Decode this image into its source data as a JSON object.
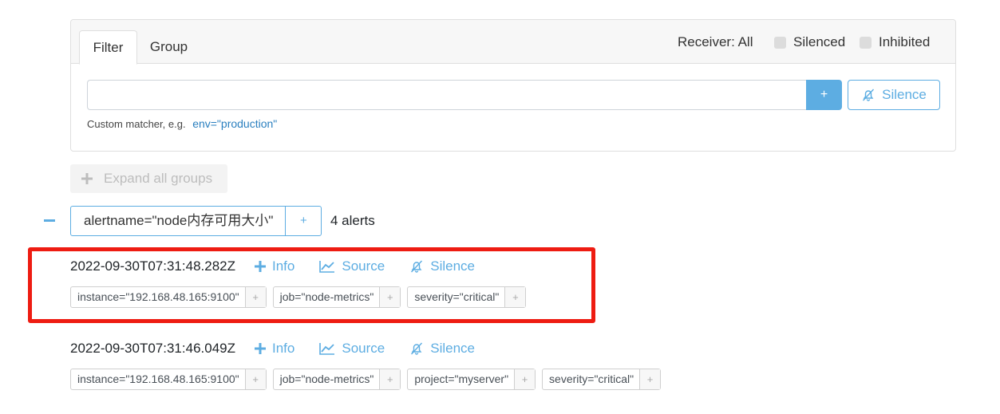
{
  "filter_card": {
    "tabs": [
      {
        "label": "Filter"
      },
      {
        "label": "Group"
      }
    ],
    "receiver": "Receiver: All",
    "silenced_label": "Silenced",
    "inhibited_label": "Inhibited",
    "input_value": "",
    "add_label": "+",
    "silence_label": "Silence",
    "hint_text": "Custom matcher, e.g.",
    "hint_example": "env=\"production\""
  },
  "expand_label": "Expand all groups",
  "group": {
    "label": "alertname=\"node内存可用大小\"",
    "plus": "+",
    "count": "4 alerts"
  },
  "alerts": [
    {
      "timestamp": "2022-09-30T07:31:48.282Z",
      "info": "Info",
      "source": "Source",
      "silence": "Silence",
      "labels": [
        "instance=\"192.168.48.165:9100\"",
        "job=\"node-metrics\"",
        "severity=\"critical\""
      ]
    },
    {
      "timestamp": "2022-09-30T07:31:46.049Z",
      "info": "Info",
      "source": "Source",
      "silence": "Silence",
      "labels": [
        "instance=\"192.168.48.165:9100\"",
        "job=\"node-metrics\"",
        "project=\"myserver\"",
        "severity=\"critical\""
      ]
    }
  ],
  "label_plus": "+",
  "colors": {
    "accent": "#5dade2",
    "highlight": "#ee1c12"
  }
}
